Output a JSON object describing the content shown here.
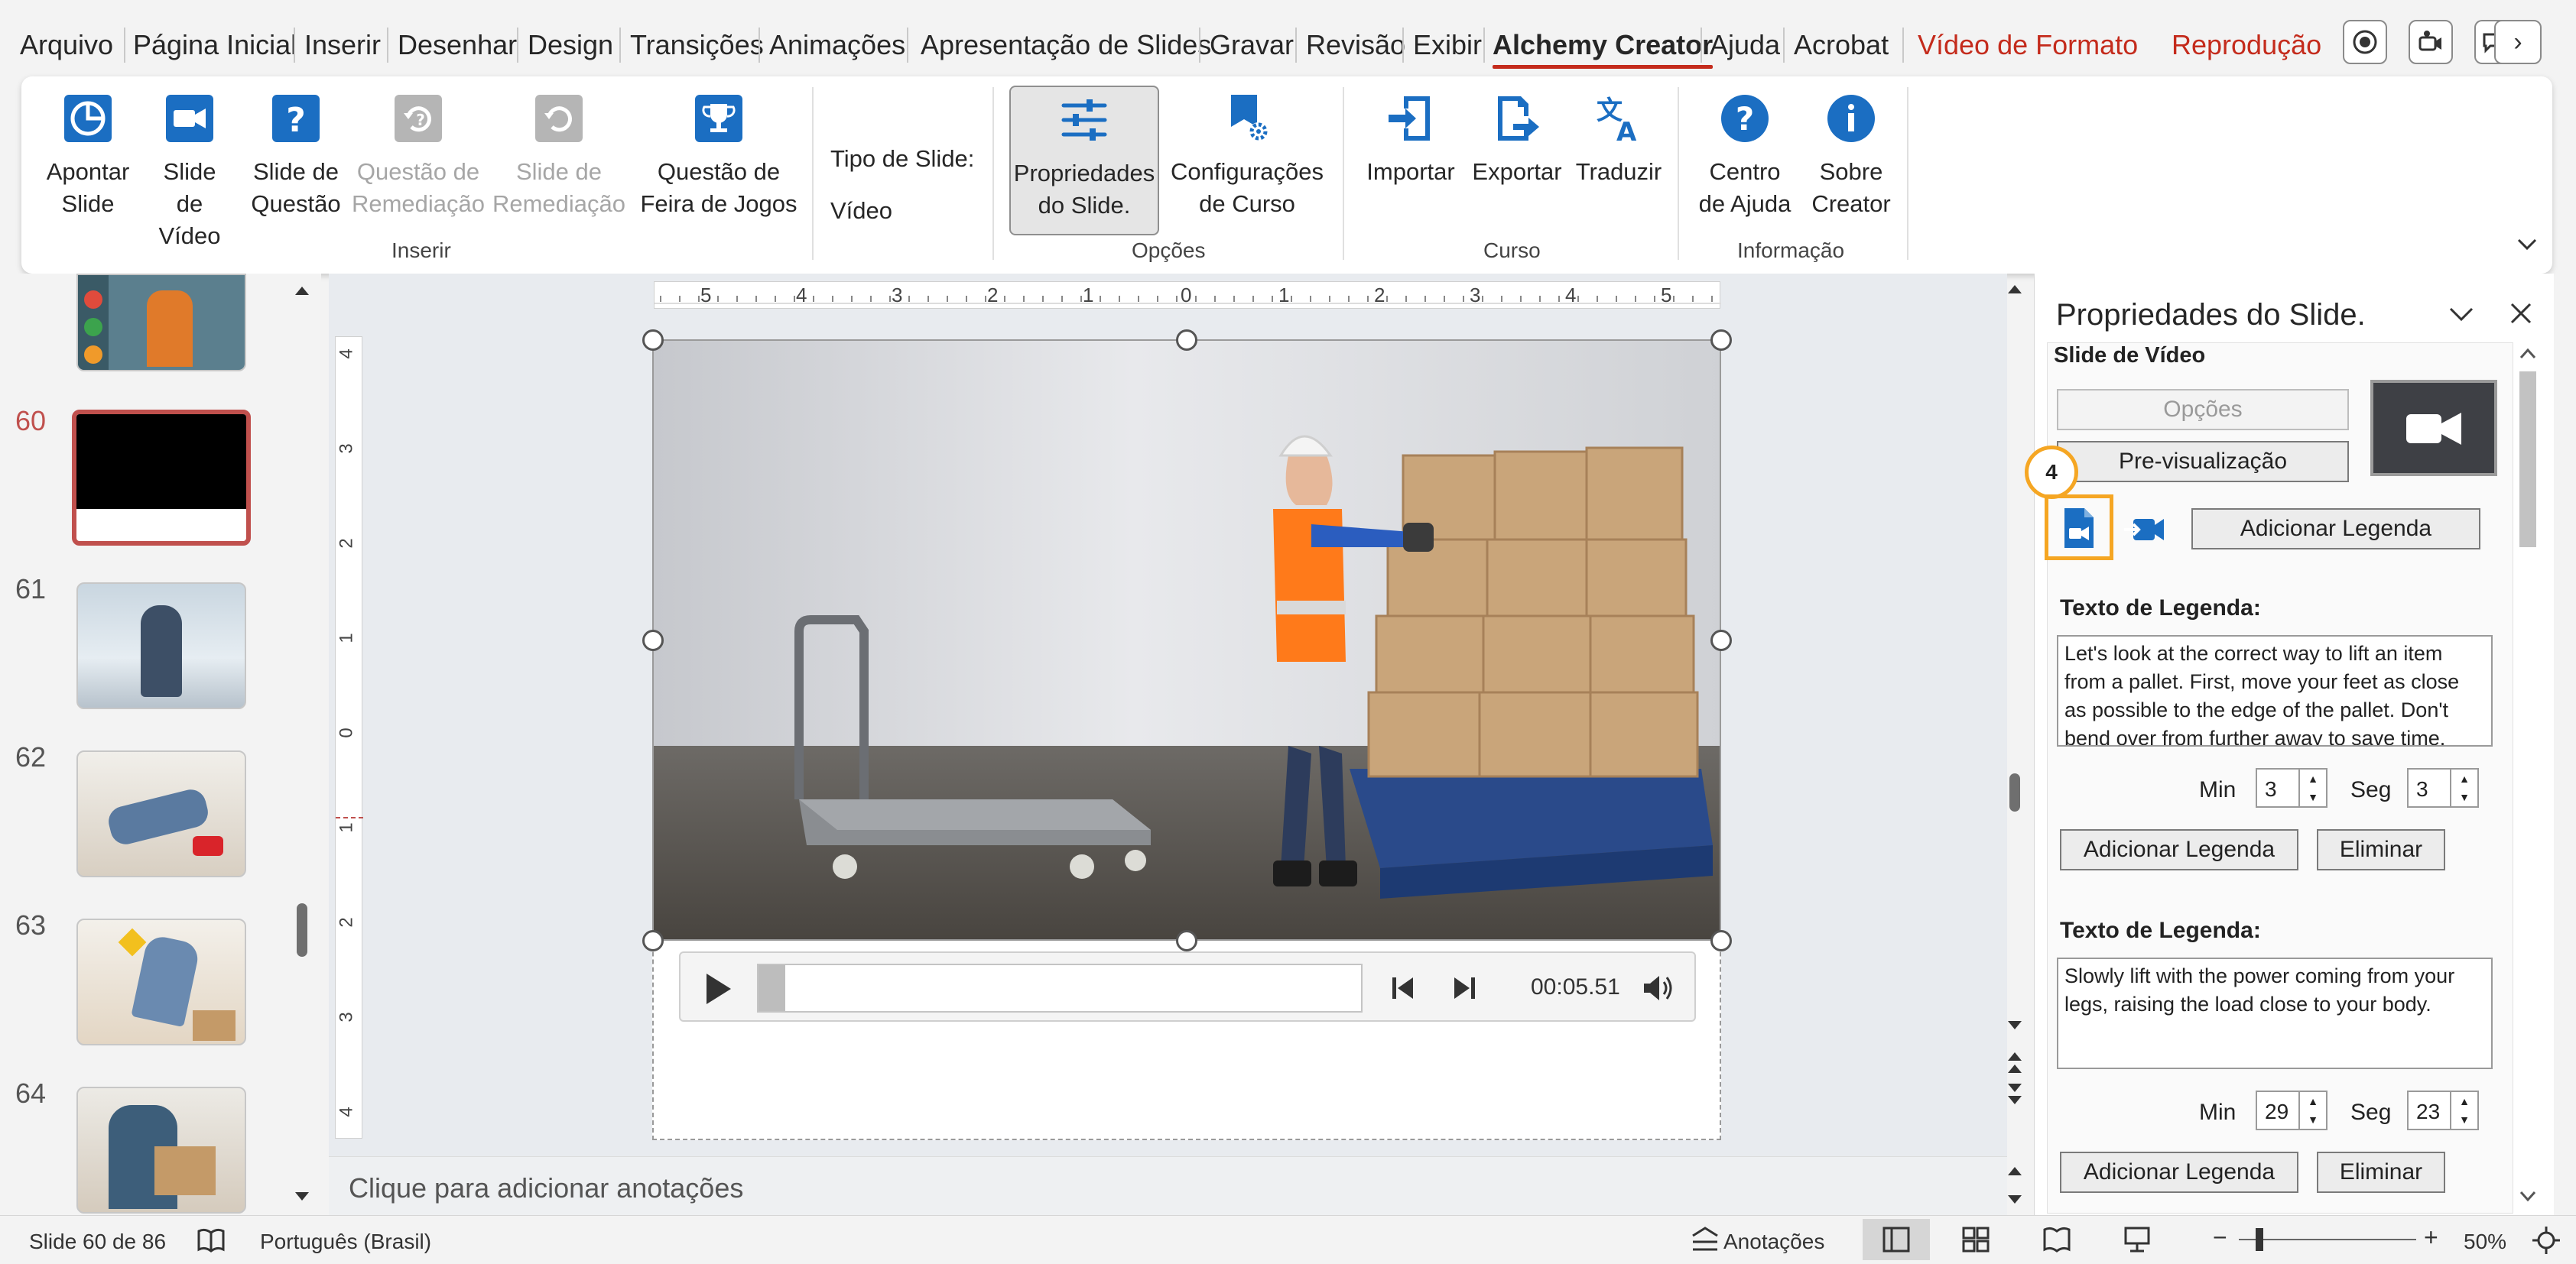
{
  "menu": {
    "tabs": [
      "Arquivo",
      "Página Inicial",
      "Inserir",
      "Desenhar",
      "Design",
      "Transições",
      "Animações",
      "Apresentação de Slides",
      "Gravar",
      "Revisão",
      "Exibir",
      "Alchemy Creator",
      "Ajuda",
      "Acrobat",
      "Vídeo de Formato",
      "Reprodução"
    ],
    "active_tab": "Alchemy Creator",
    "more_glyph": "›"
  },
  "ribbon": {
    "inserir": {
      "group_label": "Inserir",
      "apontar_line1": "Apontar",
      "apontar_line2": "Slide",
      "video_line1": "Slide de",
      "video_line2": "Vídeo",
      "questao_line1": "Slide de",
      "questao_line2": "Questão",
      "qremed_line1": "Questão de",
      "qremed_line2": "Remediação",
      "sremed_line1": "Slide de",
      "sremed_line2": "Remediação",
      "jogos_line1": "Questão de",
      "jogos_line2": "Feira de Jogos"
    },
    "tipo_label": "Tipo de Slide:",
    "tipo_value": "Vídeo",
    "opcoes": {
      "group_label": "Opções",
      "props_line1": "Propriedades",
      "props_line2": "do Slide.",
      "config_line1": "Configurações",
      "config_line2": "de Curso"
    },
    "curso": {
      "group_label": "Curso",
      "importar": "Importar",
      "exportar": "Exportar",
      "traduzir": "Traduzir"
    },
    "informacao": {
      "group_label": "Informação",
      "ajuda_line1": "Centro",
      "ajuda_line2": "de Ajuda",
      "sobre_line1": "Sobre",
      "sobre_line2": "Creator"
    }
  },
  "thumbnails": [
    {
      "number": "60",
      "active": true
    },
    {
      "number": "61"
    },
    {
      "number": "62"
    },
    {
      "number": "63"
    },
    {
      "number": "64"
    }
  ],
  "ruler_h": [
    "5",
    "4",
    "3",
    "2",
    "1",
    "0",
    "1",
    "2",
    "3",
    "4",
    "5"
  ],
  "ruler_v": [
    "4",
    "3",
    "2",
    "1",
    "0",
    "1",
    "2",
    "3",
    "4"
  ],
  "player": {
    "time": "00:05.51",
    "progress": 0.045
  },
  "notes_placeholder": "Clique para adicionar anotações",
  "props": {
    "title": "Propriedades do Slide.",
    "section": "Slide de Vídeo",
    "opcoes_btn": "Opções",
    "preview_btn": "Pre-visualização",
    "badge": "4",
    "add_legend_top": "Adicionar Legenda",
    "captions": [
      {
        "label": "Texto de Legenda:",
        "text": "Let's look at the correct way to lift an item from a pallet. First, move your feet as close as possible to the edge of the pallet. Don't bend over from further away to save time.",
        "min_label": "Min",
        "min": "3",
        "sec_label": "Seg",
        "sec": "3",
        "add_btn": "Adicionar Legenda",
        "del_btn": "Eliminar"
      },
      {
        "label": "Texto de Legenda:",
        "text": "Slowly lift with the power coming from your legs, raising the load close to your body.",
        "min_label": "Min",
        "min": "29",
        "sec_label": "Seg",
        "sec": "23",
        "add_btn": "Adicionar Legenda",
        "del_btn": "Eliminar"
      }
    ]
  },
  "status": {
    "slide": "Slide 60 de 86",
    "language": "Português (Brasil)",
    "notes": "Anotações",
    "zoom": "50%",
    "minus": "−",
    "plus": "+"
  },
  "colors": {
    "accent_blue": "#1b6ec2",
    "accent_red": "#c42b1c",
    "highlight": "#f5a623"
  }
}
